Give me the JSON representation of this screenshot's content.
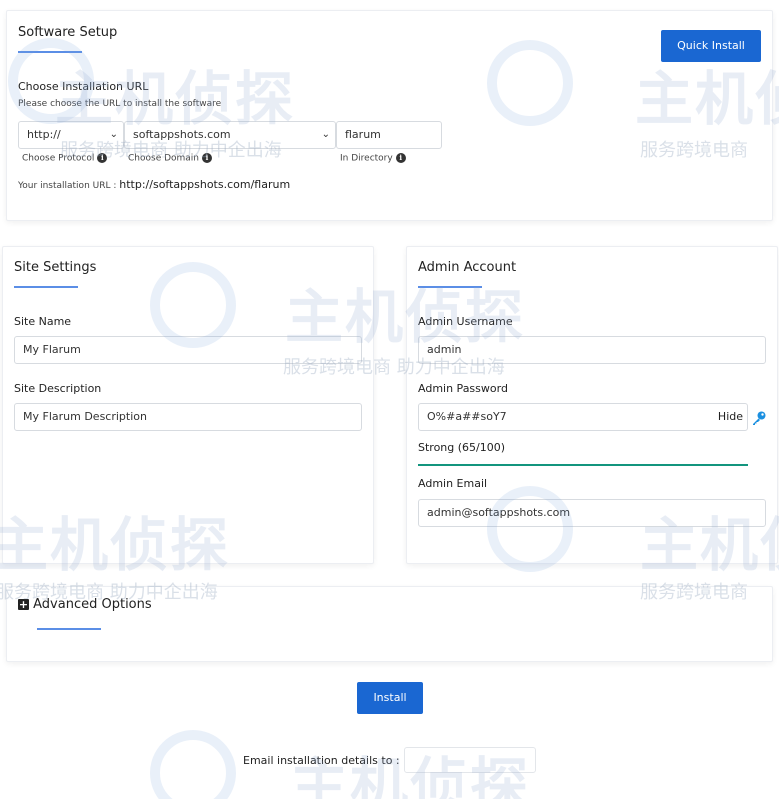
{
  "software_setup": {
    "title": "Software Setup",
    "quick_install_label": "Quick Install",
    "choose_url_heading": "Choose Installation URL",
    "choose_url_help": "Please choose the URL to install the software",
    "protocol_value": "http://",
    "protocol_label": "Choose Protocol",
    "domain_value": "softappshots.com",
    "domain_label": "Choose Domain",
    "directory_value": "flarum",
    "directory_label": "In Directory",
    "install_url_prefix": "Your installation URL :",
    "install_url_value": "http://softappshots.com/flarum"
  },
  "site_settings": {
    "title": "Site Settings",
    "site_name_label": "Site Name",
    "site_name_value": "My Flarum",
    "site_description_label": "Site Description",
    "site_description_value": "My Flarum Description"
  },
  "admin_account": {
    "title": "Admin Account",
    "username_label": "Admin Username",
    "username_value": "admin",
    "password_label": "Admin Password",
    "password_value": "O%#a##soY7",
    "hide_label": "Hide",
    "strength_text": "Strong (65/100)",
    "strength_score": 65,
    "email_label": "Admin Email",
    "email_value": "admin@softappshots.com"
  },
  "advanced": {
    "toggle_symbol": "+",
    "title": "Advanced Options"
  },
  "footer": {
    "install_label": "Install",
    "email_details_label": "Email installation details to :",
    "email_details_value": ""
  },
  "watermark": {
    "brand": "主机侦探",
    "tagline_a": "服务跨境电商",
    "tagline_b": "助力中企出海"
  },
  "colors": {
    "primary": "#1a67d2",
    "accent_underline": "#5b8ee6",
    "strength_bar": "#13957e"
  }
}
